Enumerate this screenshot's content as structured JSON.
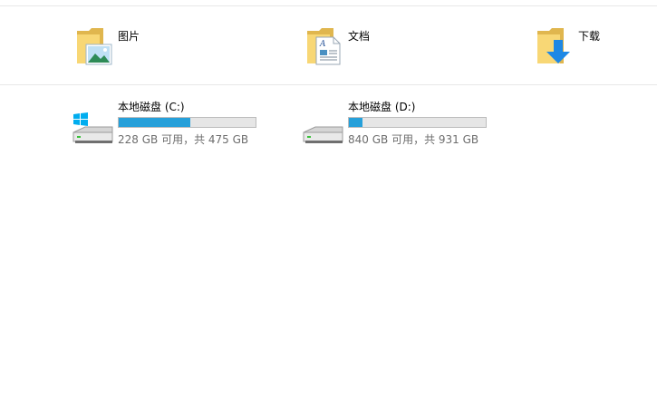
{
  "folders": [
    {
      "label": "图片",
      "icon": "pictures-folder-icon"
    },
    {
      "label": "文档",
      "icon": "documents-folder-icon"
    },
    {
      "label": "下载",
      "icon": "downloads-folder-icon"
    }
  ],
  "drives": [
    {
      "label": "本地磁盘 (C:)",
      "space_text": "228 GB 可用，共 475 GB",
      "used_fraction": 0.52,
      "icon": "windows-drive-icon"
    },
    {
      "label": "本地磁盘 (D:)",
      "space_text": "840 GB 可用，共 931 GB",
      "used_fraction": 0.098,
      "icon": "hard-drive-icon"
    }
  ],
  "colors": {
    "usage_bar": "#26a0da",
    "usage_track": "#e6e6e6",
    "folder_yellow": "#f8d775",
    "windows_blue": "#00adef",
    "download_arrow": "#1e88e5"
  }
}
